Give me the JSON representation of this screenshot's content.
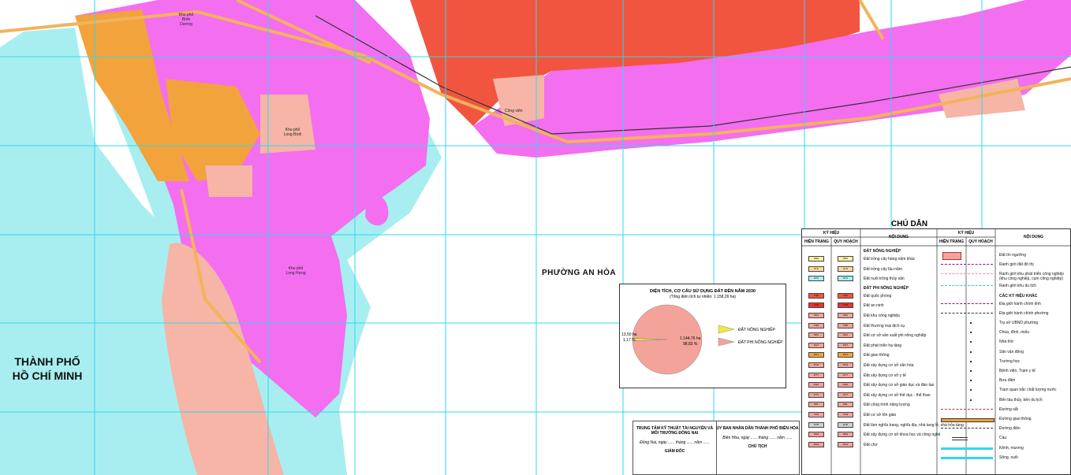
{
  "map": {
    "city_hcm": "THÀNH PHỐ\nHỒ CHÍ MINH",
    "ward_an_hoa": "PHƯỜNG AN HÒA",
    "labels": {
      "long_binh": "Khu phố Long Bình",
      "long_hung": "Khu phố Long Hưng",
      "binh_duong": "Khu phố Bình Dương",
      "cong_vien": "Công viên"
    },
    "colors": {
      "river": "#a8eef0",
      "residential": "#f46ef0",
      "defense": "#f2553f",
      "transport": "#f2a33b",
      "park": "#f6b5a6",
      "grid": "#2fd8f0",
      "road": "#f2b35a",
      "rail": "#333333"
    }
  },
  "chart_data": {
    "type": "pie",
    "title": "DIỆN TÍCH, CƠ CẤU SỬ DỤNG ĐẤT ĐẾN NĂM 2030",
    "subtitle": "(Tổng diện tích tự nhiên: 1.158,26 ha)",
    "categories": [
      "ĐẤT NÔNG NGHIỆP",
      "ĐẤT PHI NÔNG NGHIỆP"
    ],
    "values": [
      13.5,
      1144.76
    ],
    "value_labels": [
      "13,50 ha",
      "1.144,76 ha"
    ],
    "percent_labels": [
      "1,17 %",
      "98,83 %"
    ],
    "colors": [
      "#f2ea3a",
      "#f4a39a"
    ],
    "legend_position": "right"
  },
  "sign": {
    "left_title": "TRUNG TÂM KỸ THUẬT TÀI NGUYÊN VÀ MÔI TRƯỜNG ĐỒNG NAI",
    "left_date": "Đồng Nai, ngày ...... tháng ...... năm ......",
    "left_role": "GIÁM ĐỐC",
    "right_title": "ỦY BAN NHÂN DÂN THÀNH PHỐ BIÊN HÒA",
    "right_date": "Biên Hòa, ngày ...... tháng ...... năm ......",
    "right_role": "CHỦ TỊCH"
  },
  "legend": {
    "title": "CHÚ DẪN",
    "col_kyhieu": "KÝ HIỆU",
    "col_hientrang": "HIỆN TRẠNG",
    "col_quyhoach": "QUY HOẠCH",
    "col_noidung": "NỘI DUNG",
    "left_sections": [
      {
        "kind": "sec",
        "text": "ĐẤT NÔNG NGHIỆP"
      },
      {
        "kind": "row",
        "text": "Đất trồng cây hàng năm khác",
        "code": "HNK",
        "c1": "#fff0a8",
        "c2": "#fff0a8"
      },
      {
        "kind": "row",
        "text": "Đất trồng cây lâu năm",
        "code": "CLN",
        "c1": "#ffd8a0",
        "c2": "#ffd8a0"
      },
      {
        "kind": "row",
        "text": "Đất nuôi trồng thủy sản",
        "code": "NTS",
        "c1": "#a8f0f4",
        "c2": "#a8f0f4"
      },
      {
        "kind": "sec",
        "text": "ĐẤT PHI NÔNG NGHIỆP"
      },
      {
        "kind": "row",
        "text": "Đất quốc phòng",
        "code": "CQP",
        "c1": "#f2553f",
        "c2": "#f2553f"
      },
      {
        "kind": "row",
        "text": "Đất an ninh",
        "code": "CAN",
        "c1": "#f23030",
        "c2": "#f23030"
      },
      {
        "kind": "row",
        "text": "Đất khu công nghiệp",
        "code": "SKK",
        "c1": "#f4a39a",
        "c2": "#f4a39a"
      },
      {
        "kind": "row",
        "text": "Đất thương mại dịch vụ",
        "code": "TMD",
        "c1": "#f4a39a",
        "c2": "#f4a39a"
      },
      {
        "kind": "row",
        "text": "Đất cơ sở sản xuất phi nông nghiệp",
        "code": "SKC",
        "c1": "#f4a39a",
        "c2": "#f4a39a"
      },
      {
        "kind": "row",
        "text": "Đất phát triển hạ tầng",
        "code": "DHT",
        "c1": "#f4a39a",
        "c2": "#f4a39a"
      },
      {
        "kind": "row",
        "text": "Đất giao thông",
        "code": "DGT",
        "c1": "#f2a33b",
        "c2": "#f2a33b"
      },
      {
        "kind": "row",
        "text": "Đất xây dựng cơ sở văn hóa",
        "code": "DVH",
        "c1": "#f4a39a",
        "c2": "#f4a39a"
      },
      {
        "kind": "row",
        "text": "Đất xây dựng cơ sở y tế",
        "code": "DYT",
        "c1": "#f4a39a",
        "c2": "#f4a39a"
      },
      {
        "kind": "row",
        "text": "Đất xây dựng cơ sở giáo dục và đào tạo",
        "code": "DGD",
        "c1": "#f4a39a",
        "c2": "#f4a39a"
      },
      {
        "kind": "row",
        "text": "Đất xây dựng cơ sở thể dục - thể thao",
        "code": "DTT",
        "c1": "#f4a39a",
        "c2": "#f4a39a"
      },
      {
        "kind": "row",
        "text": "Đất công trình năng lượng",
        "code": "DNL",
        "c1": "#f4a39a",
        "c2": "#f4a39a"
      },
      {
        "kind": "row",
        "text": "Đất cơ sở tôn giáo",
        "code": "TON",
        "c1": "#f4a39a",
        "c2": "#f4a39a"
      },
      {
        "kind": "row",
        "text": "Đất làm nghĩa trang, nghĩa địa, nhà tang lễ, nhà hỏa táng",
        "code": "NTD",
        "c1": "#d0d0d0",
        "c2": "#d0d0d0"
      },
      {
        "kind": "row",
        "text": "Đất xây dựng cơ sở khoa học và công nghệ",
        "code": "DKH",
        "c1": "#f4a39a",
        "c2": "#f4a39a"
      },
      {
        "kind": "row",
        "text": "Đất chợ",
        "code": "DCH",
        "c1": "#f4a39a",
        "c2": "#f4a39a"
      }
    ],
    "right_rows": [
      {
        "kind": "row",
        "text": "Đất tín ngưỡng",
        "sym": "box"
      },
      {
        "kind": "row",
        "text": "Ranh giới đất đô thị",
        "sym": "dash-purple"
      },
      {
        "kind": "row",
        "text": "Ranh giới khu phát triển công nghiệp (khu công nghiệp, cụm công nghiệp)",
        "sym": "dash-pink"
      },
      {
        "kind": "row",
        "text": "Ranh giới khu du lịch",
        "sym": "dash-cyan"
      },
      {
        "kind": "sec",
        "text": "CÁC KÝ HIỆU KHÁC"
      },
      {
        "kind": "row",
        "text": "Địa giới hành chính tỉnh",
        "sym": "dashdot"
      },
      {
        "kind": "row",
        "text": "Địa giới hành chính phường",
        "sym": "dashdot2"
      },
      {
        "kind": "row",
        "text": "Trụ sở UBND phường",
        "sym": "dot"
      },
      {
        "kind": "row",
        "text": "Chùa, đình, miếu",
        "sym": "dot"
      },
      {
        "kind": "row",
        "text": "Nhà thờ",
        "sym": "dot"
      },
      {
        "kind": "row",
        "text": "Sân vận động",
        "sym": "dot"
      },
      {
        "kind": "row",
        "text": "Trường học",
        "sym": "dot"
      },
      {
        "kind": "row",
        "text": "Bệnh viện, Trạm y tế",
        "sym": "dot"
      },
      {
        "kind": "row",
        "text": "Bưu điện",
        "sym": "dot"
      },
      {
        "kind": "row",
        "text": "Trạm quan trắc chất lượng nước",
        "sym": "dot"
      },
      {
        "kind": "row",
        "text": "Bến tàu thủy, bến du lịch",
        "sym": "dot"
      },
      {
        "kind": "row",
        "text": "Đường sắt",
        "sym": "rail"
      },
      {
        "kind": "row",
        "text": "Đường giao thông",
        "sym": "road"
      },
      {
        "kind": "row",
        "text": "Đường điện",
        "sym": "power"
      },
      {
        "kind": "row",
        "text": "Cầu",
        "sym": "bridge"
      },
      {
        "kind": "row",
        "text": "Kênh, mương",
        "sym": "canal"
      },
      {
        "kind": "row",
        "text": "Sông, suối",
        "sym": "river"
      }
    ]
  }
}
